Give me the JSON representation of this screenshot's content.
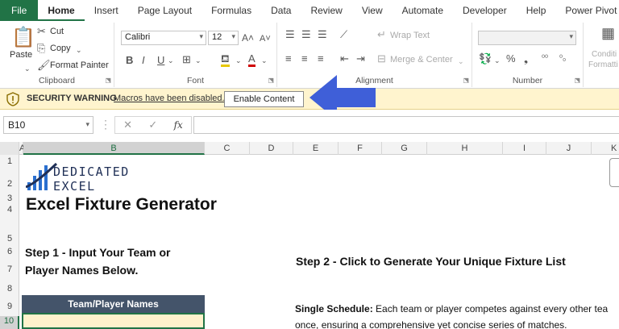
{
  "tabs": [
    "File",
    "Home",
    "Insert",
    "Page Layout",
    "Formulas",
    "Data",
    "Review",
    "View",
    "Automate",
    "Developer",
    "Help",
    "Power Pivot"
  ],
  "ribbon": {
    "clipboard": {
      "paste": "Paste",
      "cut": "Cut",
      "copy": "Copy",
      "format_painter": "Format Painter",
      "label": "Clipboard"
    },
    "font": {
      "name": "Calibri",
      "size": "12",
      "label": "Font"
    },
    "alignment": {
      "wrap": "Wrap Text",
      "merge": "Merge & Center",
      "label": "Alignment"
    },
    "number": {
      "label": "Number"
    },
    "styles": {
      "cond1": "Conditi",
      "cond2": "Formatti"
    }
  },
  "security": {
    "title": "SECURITY WARNING",
    "message": "Macros have been disabled.",
    "button": "Enable Content"
  },
  "formula_bar": {
    "name_box": "B10",
    "fx": "fx"
  },
  "columns": [
    "A",
    "B",
    "C",
    "D",
    "E",
    "F",
    "G",
    "H",
    "I",
    "J",
    "K"
  ],
  "rows": [
    "1",
    "2",
    "3",
    "4",
    "5",
    "6",
    "7",
    "8",
    "9",
    "10"
  ],
  "sheet": {
    "logo_line1": "DEDICATED",
    "logo_line2": "EXCEL",
    "title": "Excel Fixture Generator",
    "step1_line1": "Step 1 - Input Your Team or",
    "step1_line2": "Player Names Below.",
    "step2": "Step 2 - Click to Generate Your Unique Fixture List",
    "team_header": "Team/Player Names",
    "single_label": "Single Schedule:",
    "single_line1": " Each team or player competes against every other tea",
    "single_line2": "once, ensuring a comprehensive yet concise series of matches."
  },
  "colors": {
    "excel_green": "#217346",
    "warning_bg": "#fff4ce",
    "arrow_blue": "#3f5fd8",
    "header_fill": "#44546a",
    "cell_fill": "#fff2cc"
  }
}
